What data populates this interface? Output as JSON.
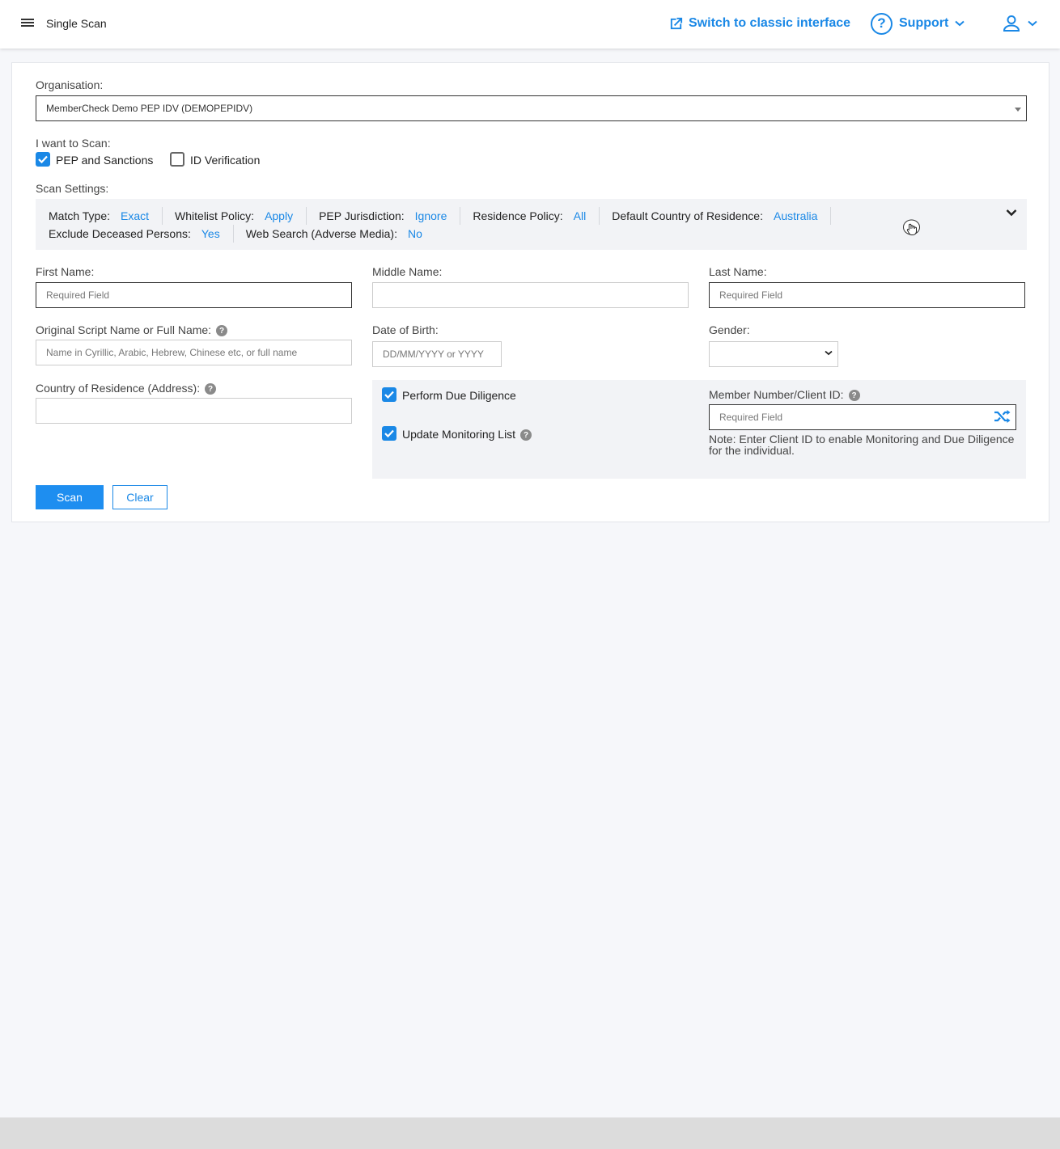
{
  "header": {
    "page_title": "Single Scan",
    "classic_link": "Switch to classic interface",
    "support_label": "Support"
  },
  "organisation": {
    "label": "Organisation:",
    "value": "MemberCheck Demo PEP IDV (DEMOPEPIDV)"
  },
  "scan_types": {
    "label": "I want to Scan:",
    "options": [
      {
        "label": "PEP and Sanctions",
        "checked": true
      },
      {
        "label": "ID Verification",
        "checked": false
      }
    ]
  },
  "scan_settings": {
    "label": "Scan Settings:",
    "row1": [
      {
        "key": "Match Type:",
        "value": "Exact"
      },
      {
        "key": "Whitelist Policy:",
        "value": "Apply"
      },
      {
        "key": "PEP Jurisdiction:",
        "value": "Ignore"
      },
      {
        "key": "Residence Policy:",
        "value": "All"
      },
      {
        "key": "Default Country of Residence:",
        "value": "Australia"
      }
    ],
    "row2": [
      {
        "key": "Exclude Deceased Persons:",
        "value": "Yes"
      },
      {
        "key": "Web Search (Adverse Media):",
        "value": "No"
      }
    ]
  },
  "form": {
    "first_name": {
      "label": "First Name:",
      "placeholder": "Required Field"
    },
    "middle_name": {
      "label": "Middle Name:",
      "placeholder": ""
    },
    "last_name": {
      "label": "Last Name:",
      "placeholder": "Required Field"
    },
    "original_script": {
      "label": "Original Script Name or Full Name:",
      "placeholder": "Name in Cyrillic, Arabic, Hebrew, Chinese etc, or full name"
    },
    "dob": {
      "label": "Date of Birth:",
      "placeholder": "DD/MM/YYYY or YYYY"
    },
    "gender": {
      "label": "Gender:",
      "value": ""
    },
    "country": {
      "label": "Country of Residence (Address):",
      "placeholder": ""
    }
  },
  "monitoring": {
    "due_diligence": {
      "label": "Perform Due Diligence",
      "checked": true
    },
    "monitoring_list": {
      "label": "Update Monitoring List",
      "checked": true
    },
    "client_id": {
      "label": "Member Number/Client ID:",
      "placeholder": "Required Field"
    },
    "note": "Note: Enter Client ID to enable Monitoring and Due Diligence for the individual."
  },
  "actions": {
    "scan": "Scan",
    "clear": "Clear"
  },
  "colors": {
    "accent": "#1a88e6",
    "page_bg": "#f6f7fa",
    "panel_bg": "#f2f3f6"
  },
  "icons": [
    "menu-icon",
    "external-link-icon",
    "help-circle-icon",
    "chevron-down-icon",
    "user-icon",
    "shuffle-icon",
    "question-icon",
    "cursor-icon"
  ]
}
